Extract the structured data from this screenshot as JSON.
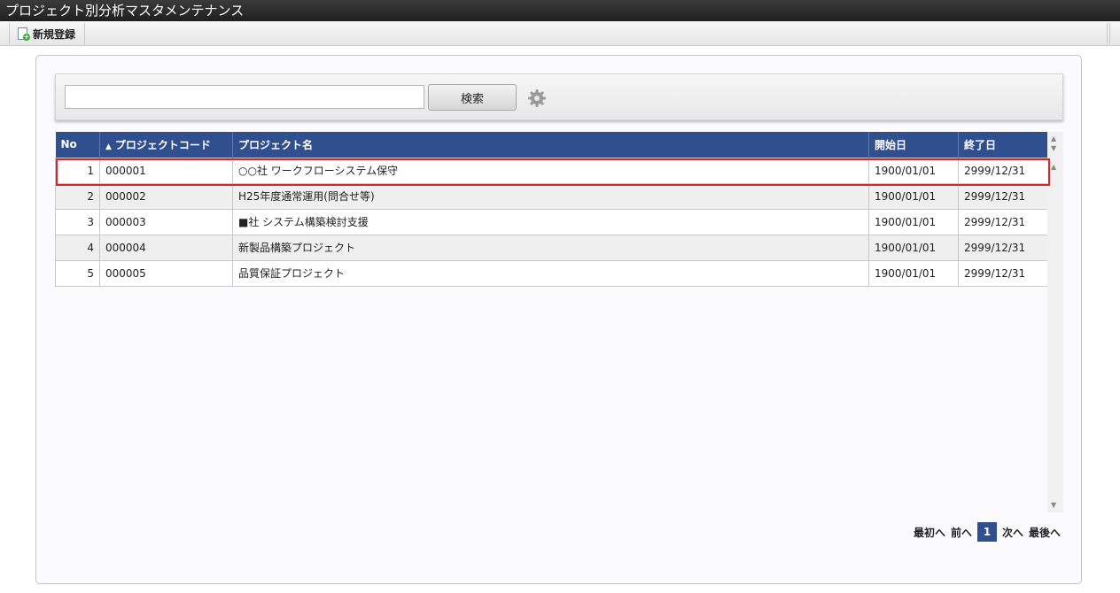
{
  "window": {
    "title": "プロジェクト別分析マスタメンテナンス"
  },
  "toolbar": {
    "new_label": "新規登録"
  },
  "search": {
    "value": "",
    "placeholder": "",
    "button_label": "検索"
  },
  "table": {
    "columns": [
      "No",
      "プロジェクトコード",
      "プロジェクト名",
      "開始日",
      "終了日"
    ],
    "sort_indicator": "▲",
    "rows": [
      {
        "no": "1",
        "code": "000001",
        "name": "○○社 ワークフローシステム保守",
        "start": "1900/01/01",
        "end": "2999/12/31"
      },
      {
        "no": "2",
        "code": "000002",
        "name": "H25年度通常運用(問合せ等)",
        "start": "1900/01/01",
        "end": "2999/12/31"
      },
      {
        "no": "3",
        "code": "000003",
        "name": "■社 システム構築検討支援",
        "start": "1900/01/01",
        "end": "2999/12/31"
      },
      {
        "no": "4",
        "code": "000004",
        "name": "新製品構築プロジェクト",
        "start": "1900/01/01",
        "end": "2999/12/31"
      },
      {
        "no": "5",
        "code": "000005",
        "name": "品質保証プロジェクト",
        "start": "1900/01/01",
        "end": "2999/12/31"
      }
    ]
  },
  "pager": {
    "first": "最初へ",
    "prev": "前へ",
    "current": "1",
    "next": "次へ",
    "last": "最後へ"
  },
  "colors": {
    "header_bg": "#2f4f8f",
    "highlight": "#d9232a",
    "titlebar_bg": "#2b2b2b"
  },
  "icons": {
    "new": "document-add-icon",
    "settings": "gear-icon"
  }
}
